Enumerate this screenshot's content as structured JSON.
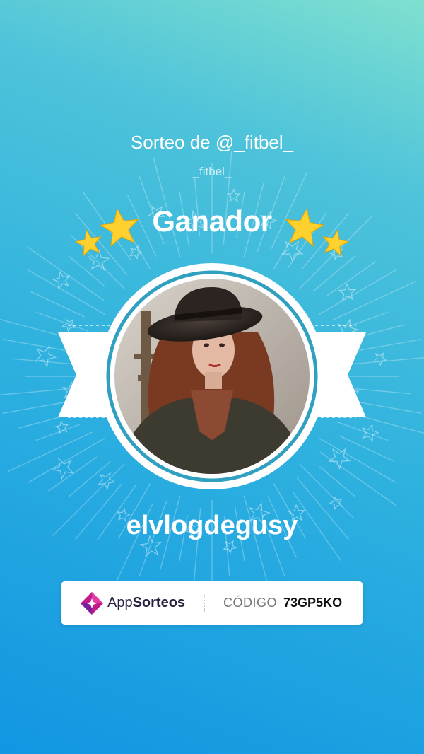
{
  "header": {
    "title": "Sorteo de @_fitbel_",
    "subtitle": "_fitbel_"
  },
  "award": {
    "heading": "Ganador",
    "winner_name": "elvlogdegusy",
    "avatar_icon": "profile-photo"
  },
  "footer": {
    "brand_app": "App",
    "brand_sorteos": "Sorteos",
    "brand_logo_icon": "appsorteos-logo-icon",
    "code_label": "CÓDIGO",
    "code_value": "73GP5KO"
  },
  "colors": {
    "gradient_top": "#7fe0cf",
    "gradient_bottom": "#1196e2",
    "star": "#ffd12e",
    "ring": "#2fa0c0",
    "brand_pink": "#c21c8a",
    "brand_purple": "#7a1fa0"
  }
}
